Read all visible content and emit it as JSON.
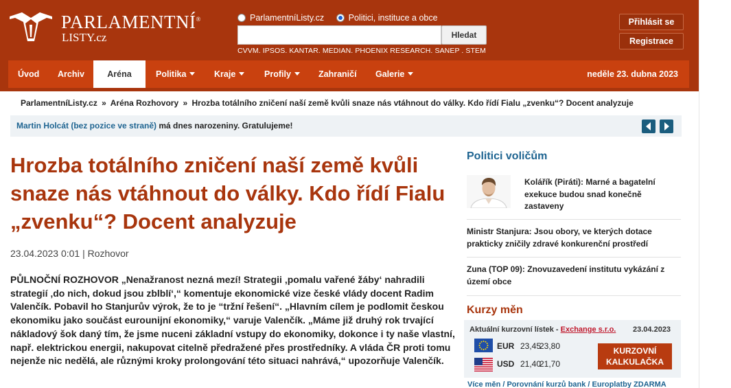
{
  "header": {
    "logo_title": "PARLAMENTNÍ",
    "logo_reg": "®",
    "logo_subtitle": "LISTY.cz",
    "search_options": [
      "ParlamentníListy.cz",
      "Politici, instituce a obce"
    ],
    "search_selected": "Politici, instituce a obce",
    "search_value": "",
    "search_button": "Hledat",
    "sources": "CVVM. IPSOS. KANTAR. MEDIAN. PHOENIX RESEARCH. SANEP . STEM",
    "login": "Přihlásit se",
    "register": "Registrace"
  },
  "nav": {
    "items": [
      "Úvod",
      "Archiv",
      "Aréna",
      "Politika",
      "Kraje",
      "Profily",
      "Zahraničí",
      "Galerie"
    ],
    "active": "Aréna",
    "date": "neděle 23. dubna 2023"
  },
  "breadcrumb": {
    "items": [
      "ParlamentníListy.cz",
      "Aréna",
      "Rozhovory",
      "Hrozba totálního zničení naší země kvůli snaze nás vtáhnout do války. Kdo řídí Fialu „zvenku“? Docent analyzuje"
    ],
    "separator": "»"
  },
  "birthday": {
    "name": "Martin Holcát (bez pozice ve straně)",
    "message": " má dnes narozeniny. Gratulujeme!"
  },
  "article": {
    "title": "Hrozba totálního zničení naší země kvůli snaze nás vtáhnout do války. Kdo řídí Fialu „zvenku“? Docent analyzuje",
    "meta": "23.04.2023 0:01 | Rozhovor",
    "perex": "PŮLNOČNÍ ROZHOVOR „Nenažranost nezná mezí! Strategii ‚pomalu vařené žáby‘ nahradili strategií ‚do nich, dokud jsou zblblí‘,“ komentuje ekonomické vize české vlády docent Radim Valenčík. Pobavil ho Stanjurův výrok, že to je “tržní řešení“. „Hlavním cílem je podlomit českou ekonomiku jako součást eurounijní ekonomiky,“ varuje Valenčík. „Máme již druhý rok trvající nákladový šok daný tím, že jsme nuceni základní vstupy do ekonomiky, dokonce i ty naše vlastní, např. elektrickou energii, nakupovat citelně předražené přes prostředníky. A vláda ČR proti tomu nejenže nic nedělá, ale různými kroky prolongování této situaci nahrává,“ upozorňuje Valenčík."
  },
  "politici": {
    "heading": "Politici voličům",
    "items": [
      "Kolářík (Piráti): Marné a bagatelní exekuce budou snad konečně zastaveny",
      "Ministr Stanjura: Jsou obory, ve kterých dotace prakticky zničily zdravé konkurenční prostředí",
      "Zuna (TOP 09): Znovuzavedení institutu vykázání z území obce"
    ]
  },
  "kurzy": {
    "heading": "Kurzy měn",
    "header_text": "Aktuální kurzovní lístek - ",
    "header_link": "Exchange s.r.o.",
    "date": "23.04.2023",
    "rows": [
      {
        "code": "EUR",
        "buy": "23,45",
        "sell": "23,80",
        "flag": "eu-flag"
      },
      {
        "code": "USD",
        "buy": "21,40",
        "sell": "21,70",
        "flag": "us-flag"
      }
    ],
    "calculator_button": "KURZOVNÍ KALKULAČKA",
    "links": "Více měn / Porovnání kurzů bank / Europlatby ZDARMA"
  },
  "colors": {
    "brand": "#a8350d",
    "nav": "#c9410f",
    "link_blue": "#1e6491",
    "panel": "#eef2f5"
  }
}
